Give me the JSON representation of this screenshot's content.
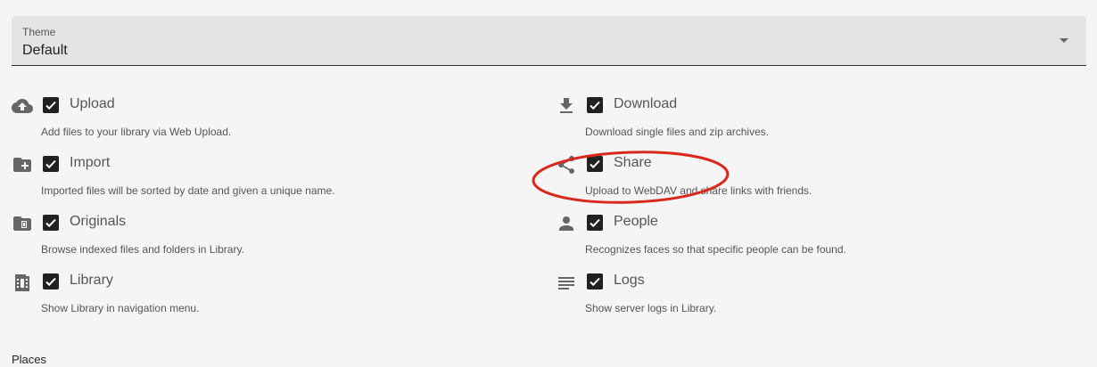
{
  "theme": {
    "label": "Theme",
    "value": "Default",
    "icon": "chevron-down-icon"
  },
  "options": {
    "upload": {
      "label": "Upload",
      "description": "Add files to your library via Web Upload.",
      "checked": true,
      "icon": "cloud-upload-icon"
    },
    "download": {
      "label": "Download",
      "description": "Download single files and zip archives.",
      "checked": true,
      "icon": "download-icon"
    },
    "import": {
      "label": "Import",
      "description": "Imported files will be sorted by date and given a unique name.",
      "checked": true,
      "icon": "folder-plus-icon"
    },
    "share": {
      "label": "Share",
      "description": "Upload to WebDAV and share links with friends.",
      "checked": true,
      "icon": "share-icon"
    },
    "originals": {
      "label": "Originals",
      "description": "Browse indexed files and folders in Library.",
      "checked": true,
      "icon": "folder-file-icon"
    },
    "people": {
      "label": "People",
      "description": "Recognizes faces so that specific people can be found.",
      "checked": true,
      "icon": "person-icon"
    },
    "library": {
      "label": "Library",
      "description": "Show Library in navigation menu.",
      "checked": true,
      "icon": "film-library-icon"
    },
    "logs": {
      "label": "Logs",
      "description": "Show server logs in Library.",
      "checked": true,
      "icon": "list-lines-icon"
    }
  },
  "places_heading": "Places",
  "colors": {
    "background": "#f5f5f5",
    "checkbox": "#212121",
    "annotation": "#d9291c"
  }
}
